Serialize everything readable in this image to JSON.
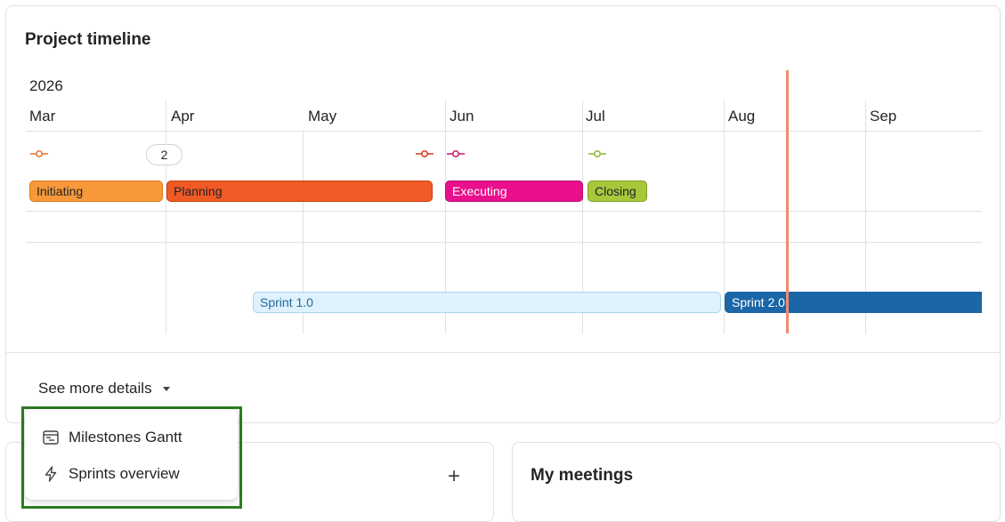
{
  "timeline": {
    "title": "Project timeline",
    "year": "2026",
    "months": [
      "Mar",
      "Apr",
      "May",
      "Jun",
      "Jul",
      "Aug",
      "Sep"
    ],
    "milestone_count": "2",
    "phases": [
      {
        "label": "Initiating",
        "color": "#f7993a",
        "border": "#d9791c",
        "text_color": "#242424"
      },
      {
        "label": "Planning",
        "color": "#f05a24",
        "border": "#c9400f",
        "text_color": "#242424"
      },
      {
        "label": "Executing",
        "color": "#ea0f8c",
        "border": "#b80a6c",
        "text_color": "#ffffff"
      },
      {
        "label": "Closing",
        "color": "#a6c83a",
        "border": "#7f9d22",
        "text_color": "#242424"
      }
    ],
    "milestone_colors": [
      "#e8702a",
      "#d9381e",
      "#c2186a",
      "#8db52e"
    ],
    "sprints": [
      {
        "label": "Sprint 1.0",
        "color": "#dff1fc",
        "border": "#a8d4ef",
        "text_color": "#1f6a9c"
      },
      {
        "label": "Sprint 2.0",
        "color": "#1a66a6",
        "border": "#1a66a6",
        "text_color": "#ffffff"
      }
    ],
    "today_color": "#f08a75"
  },
  "details": {
    "label": "See more details",
    "menu": [
      {
        "label": "Milestones Gantt",
        "icon": "gantt-icon"
      },
      {
        "label": "Sprints overview",
        "icon": "lightning-icon"
      }
    ]
  },
  "left_card": {
    "add_icon": "+"
  },
  "meetings": {
    "title": "My meetings"
  },
  "highlight_color": "#2e7d22"
}
